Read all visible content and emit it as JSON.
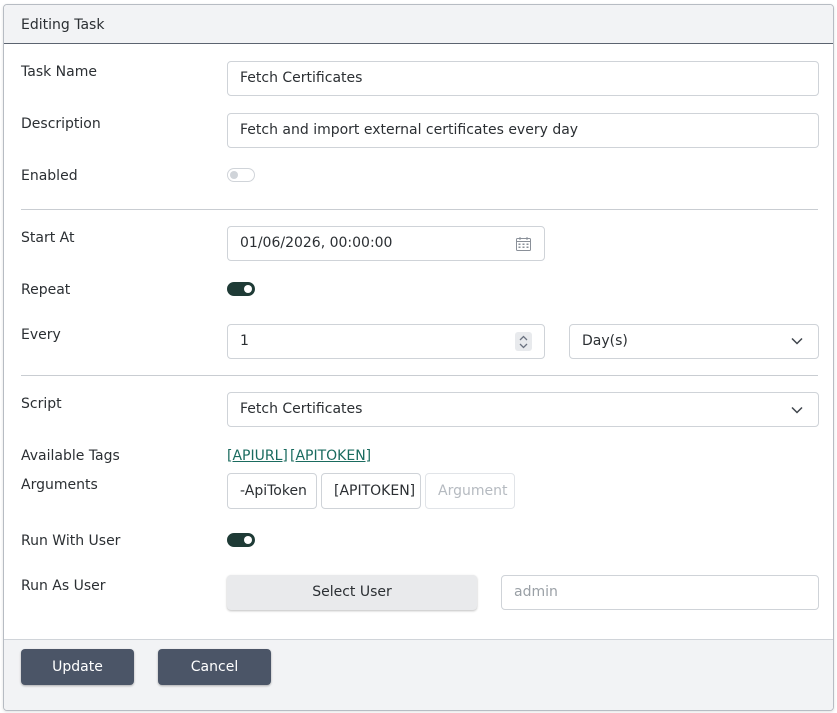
{
  "dialog": {
    "title": "Editing Task"
  },
  "fields": {
    "task_name": {
      "label": "Task Name",
      "value": "Fetch Certificates"
    },
    "description": {
      "label": "Description",
      "value": "Fetch and import external certificates every day"
    },
    "enabled": {
      "label": "Enabled",
      "checked": false
    },
    "start_at": {
      "label": "Start At",
      "value": "01/06/2026, 00:00:00",
      "icon": "calendar-icon"
    },
    "repeat": {
      "label": "Repeat",
      "checked": true
    },
    "every": {
      "label": "Every",
      "value": "1",
      "unit": "Day(s)"
    },
    "script": {
      "label": "Script",
      "value": "Fetch Certificates"
    },
    "available_tags": {
      "label": "Available Tags",
      "tags": [
        "[APIURL]",
        "[APITOKEN]"
      ]
    },
    "arguments": {
      "label": "Arguments",
      "items": [
        "-ApiToken",
        "[APITOKEN]"
      ],
      "placeholder": "Argument"
    },
    "run_with_user": {
      "label": "Run With User",
      "checked": true
    },
    "run_as_user": {
      "label": "Run As User",
      "button_label": "Select User",
      "value": "admin"
    }
  },
  "footer": {
    "update_label": "Update",
    "cancel_label": "Cancel"
  },
  "colors": {
    "toggle_on": "#1f3b36",
    "primary_button": "#4b5567",
    "tag_link": "#1a6b5f"
  }
}
